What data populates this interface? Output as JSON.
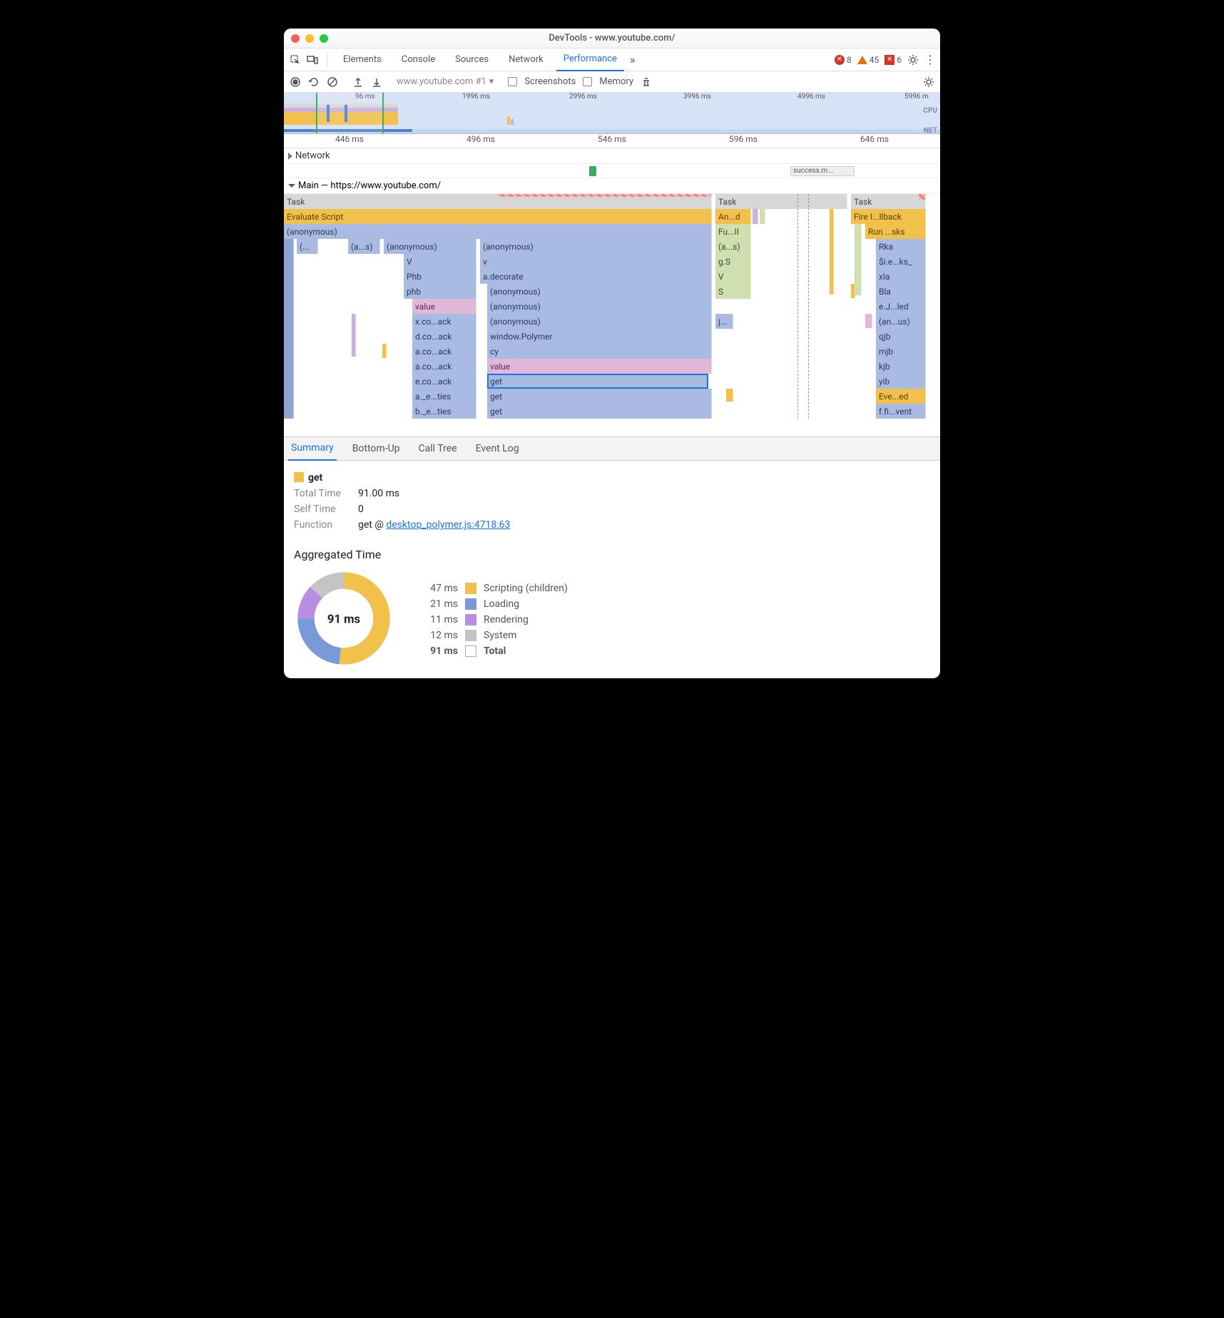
{
  "window": {
    "title": "DevTools - www.youtube.com/"
  },
  "mainTabs": {
    "elements": "Elements",
    "console": "Console",
    "sources": "Sources",
    "network": "Network",
    "performance": "Performance"
  },
  "counters": {
    "errors": "8",
    "warnings": "45",
    "xErrors": "6"
  },
  "perfToolbar": {
    "target": "www.youtube.com #1",
    "screenshots": "Screenshots",
    "memory": "Memory"
  },
  "overview": {
    "ticks": [
      "96 ms",
      "1996 ms",
      "2996 ms",
      "3996 ms",
      "4996 ms",
      "5996 m"
    ],
    "cpuLabel": "CPU",
    "netLabel": "NET"
  },
  "ruler": [
    "446 ms",
    "496 ms",
    "546 ms",
    "596 ms",
    "646 ms"
  ],
  "network": {
    "header": "Network",
    "item": "success.m..."
  },
  "mainThread": {
    "header": "Main — https://www.youtube.com/",
    "col1": {
      "task": "Task",
      "eval": "Evaluate Script",
      "anon": "(anonymous)",
      "stack1a": "(...",
      "stack1b": "(a...s)",
      "stack2": "(anonymous)",
      "stack2v": "V",
      "stack2phb1": "Phb",
      "stack2phb2": "phb",
      "stack2value": "value",
      "stack2xco": "x.co...ack",
      "stack2dco": "d.co...ack",
      "stack2aco1": "a.co...ack",
      "stack2aco2": "a.co...ack",
      "stack2eco": "e.co...ack",
      "stack2ae": "a._e...ties",
      "stack2be": "b._e...ties",
      "stack3": "(anonymous)",
      "stack3v": "v",
      "stack3dec": "a.decorate",
      "stack3anon1": "(anonymous)",
      "stack3anon2": "(anonymous)",
      "stack3anon3": "(anonymous)",
      "stack3poly": "window.Polymer",
      "stack3cy": "cy",
      "stack3value": "value",
      "stack3get": "get",
      "stack3get2": "get",
      "stack3get3": "get"
    },
    "col2": {
      "task": "Task",
      "and": "An...d",
      "full": "Fu...II",
      "as": "(a...s)",
      "gs": "g.S",
      "v": "V",
      "s": "S",
      "j": "j..."
    },
    "col3": {
      "task": "Task",
      "fire": "Fire I...llback",
      "run": "Run ...sks",
      "rka": "Rka",
      "sie": "$i.e...ks_",
      "xla": "xla",
      "bla": "Bla",
      "ej": "e.J...led",
      "anus": "(an...us)",
      "qjb": "qjb",
      "mjb": "mjb",
      "kjb": "kjb",
      "yib": "yib",
      "eve": "Eve...ed",
      "ffi": "f.fi...vent"
    }
  },
  "detailTabs": {
    "summary": "Summary",
    "bottomUp": "Bottom-Up",
    "callTree": "Call Tree",
    "eventLog": "Event Log"
  },
  "summary": {
    "name": "get",
    "totalTimeLabel": "Total Time",
    "totalTime": "91.00 ms",
    "selfTimeLabel": "Self Time",
    "selfTime": "0",
    "functionLabel": "Function",
    "functionText": "get @ ",
    "functionLink": "desktop_polymer.js:4718:63",
    "aggLabel": "Aggregated Time",
    "donutCenter": "91 ms",
    "legend": [
      {
        "ms": "47 ms",
        "color": "swatch-y",
        "label": "Scripting (children)"
      },
      {
        "ms": "21 ms",
        "color": "swatch-b",
        "label": "Loading"
      },
      {
        "ms": "11 ms",
        "color": "swatch-p",
        "label": "Rendering"
      },
      {
        "ms": "12 ms",
        "color": "swatch-g",
        "label": "System"
      },
      {
        "ms": "91 ms",
        "color": "swatch-w",
        "label": "Total"
      }
    ]
  },
  "chart_data": {
    "type": "pie",
    "title": "Aggregated Time",
    "total_label": "91 ms",
    "series": [
      {
        "name": "Scripting (children)",
        "value": 47,
        "color": "#f2c14b"
      },
      {
        "name": "Loading",
        "value": 21,
        "color": "#7a99d8"
      },
      {
        "name": "Rendering",
        "value": 11,
        "color": "#b98de0"
      },
      {
        "name": "System",
        "value": 12,
        "color": "#c4c4c4"
      }
    ],
    "unit": "ms"
  }
}
